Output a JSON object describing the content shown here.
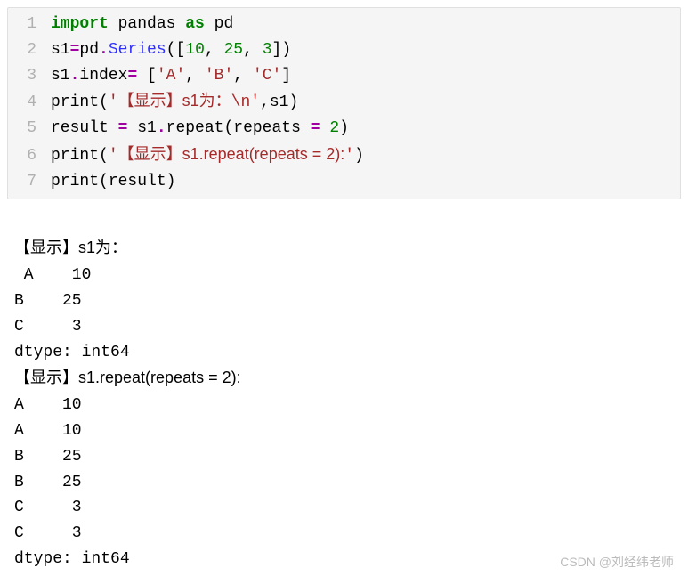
{
  "code": {
    "lines": [
      {
        "num": "1",
        "tokens": [
          {
            "t": "import",
            "c": "kw"
          },
          {
            "t": " ",
            "c": "nm"
          },
          {
            "t": "pandas ",
            "c": "nm"
          },
          {
            "t": "as",
            "c": "kw"
          },
          {
            "t": " pd",
            "c": "nm"
          }
        ]
      },
      {
        "num": "2",
        "tokens": [
          {
            "t": "s1",
            "c": "nm"
          },
          {
            "t": "=",
            "c": "op"
          },
          {
            "t": "pd",
            "c": "nm"
          },
          {
            "t": ".",
            "c": "op"
          },
          {
            "t": "Series",
            "c": "cls"
          },
          {
            "t": "([",
            "c": "nm"
          },
          {
            "t": "10",
            "c": "num"
          },
          {
            "t": ", ",
            "c": "nm"
          },
          {
            "t": "25",
            "c": "num"
          },
          {
            "t": ", ",
            "c": "nm"
          },
          {
            "t": "3",
            "c": "num"
          },
          {
            "t": "])",
            "c": "nm"
          }
        ]
      },
      {
        "num": "3",
        "tokens": [
          {
            "t": "s1",
            "c": "nm"
          },
          {
            "t": ".",
            "c": "op"
          },
          {
            "t": "index",
            "c": "nm"
          },
          {
            "t": "= ",
            "c": "op"
          },
          {
            "t": "[",
            "c": "nm"
          },
          {
            "t": "'A'",
            "c": "str"
          },
          {
            "t": ", ",
            "c": "nm"
          },
          {
            "t": "'B'",
            "c": "str"
          },
          {
            "t": ", ",
            "c": "nm"
          },
          {
            "t": "'C'",
            "c": "str"
          },
          {
            "t": "]",
            "c": "nm"
          }
        ]
      },
      {
        "num": "4",
        "tokens": [
          {
            "t": "print",
            "c": "nm"
          },
          {
            "t": "(",
            "c": "nm"
          },
          {
            "t": "'",
            "c": "str"
          },
          {
            "t": "【显示】s1为：",
            "c": "strcn"
          },
          {
            "t": "\\n",
            "c": "str"
          },
          {
            "t": "'",
            "c": "str"
          },
          {
            "t": ",s1)",
            "c": "nm"
          }
        ]
      },
      {
        "num": "5",
        "tokens": [
          {
            "t": "result ",
            "c": "nm"
          },
          {
            "t": "=",
            "c": "op"
          },
          {
            "t": " s1",
            "c": "nm"
          },
          {
            "t": ".",
            "c": "op"
          },
          {
            "t": "repeat(repeats ",
            "c": "nm"
          },
          {
            "t": "=",
            "c": "op"
          },
          {
            "t": " ",
            "c": "nm"
          },
          {
            "t": "2",
            "c": "num"
          },
          {
            "t": ")",
            "c": "nm"
          }
        ]
      },
      {
        "num": "6",
        "tokens": [
          {
            "t": "print",
            "c": "nm"
          },
          {
            "t": "(",
            "c": "nm"
          },
          {
            "t": "'",
            "c": "str"
          },
          {
            "t": "【显示】s1.repeat(repeats = 2):",
            "c": "strcn"
          },
          {
            "t": "'",
            "c": "str"
          },
          {
            "t": ")",
            "c": "nm"
          }
        ]
      },
      {
        "num": "7",
        "tokens": [
          {
            "t": "print",
            "c": "nm"
          },
          {
            "t": "(result)",
            "c": "nm"
          }
        ]
      }
    ]
  },
  "output": {
    "line1_cn": "【显示】s1为：",
    "line2": " A    10",
    "line3": "B    25",
    "line4": "C     3",
    "line5": "dtype: int64",
    "line6_cn": "【显示】s1.repeat(repeats = 2):",
    "line7": "A    10",
    "line8": "A    10",
    "line9": "B    25",
    "line10": "B    25",
    "line11": "C     3",
    "line12": "C     3",
    "line13": "dtype: int64"
  },
  "watermark": "CSDN @刘经纬老师"
}
